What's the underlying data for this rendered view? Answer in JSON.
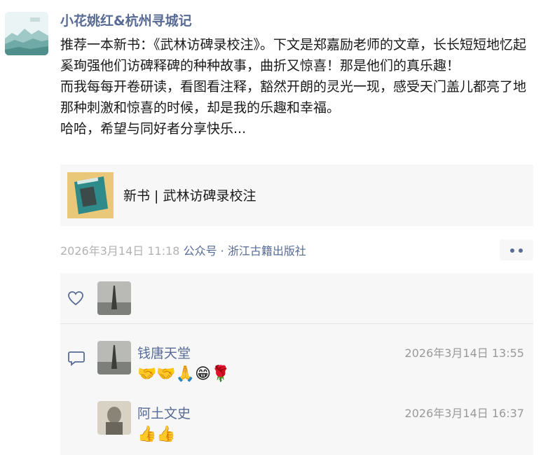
{
  "post": {
    "author": "小花姚红&杭州寻城记",
    "paragraphs": [
      "推荐一本新书：《武林访碑录校注》。下文是郑嘉励老师的文章，长长短短地忆起奚珣强他们访碑释碑的种种故事，曲折又惊喜！那是他们的真乐趣！",
      "而我每每开卷研读，看图看注释，豁然开朗的灵光一现，感受天门盖儿都亮了地那种刺激和惊喜的时候，却是我的乐趣和幸福。",
      "哈哈，希望与同好者分享快乐..."
    ],
    "share_card": {
      "title": "新书 | 武林访碑录校注"
    },
    "meta": {
      "time": "2026年3月14日 11:18",
      "source": "公众号 · 浙江古籍出版社"
    }
  },
  "comments": [
    {
      "name": "钱唐天堂",
      "time": "2026年3月14日 13:55",
      "text": "🤝🤝🙏😁🌹"
    },
    {
      "name": "阿土文史",
      "time": "2026年3月14日 16:37",
      "text": "👍👍"
    }
  ],
  "icons": {
    "like": "heart-outline-icon",
    "comment": "comment-bubble-icon",
    "more": "more-dots-icon"
  },
  "colors": {
    "link": "#576b95",
    "meta_gray": "#b2b2b2",
    "panel_bg": "#f7f7f7"
  }
}
